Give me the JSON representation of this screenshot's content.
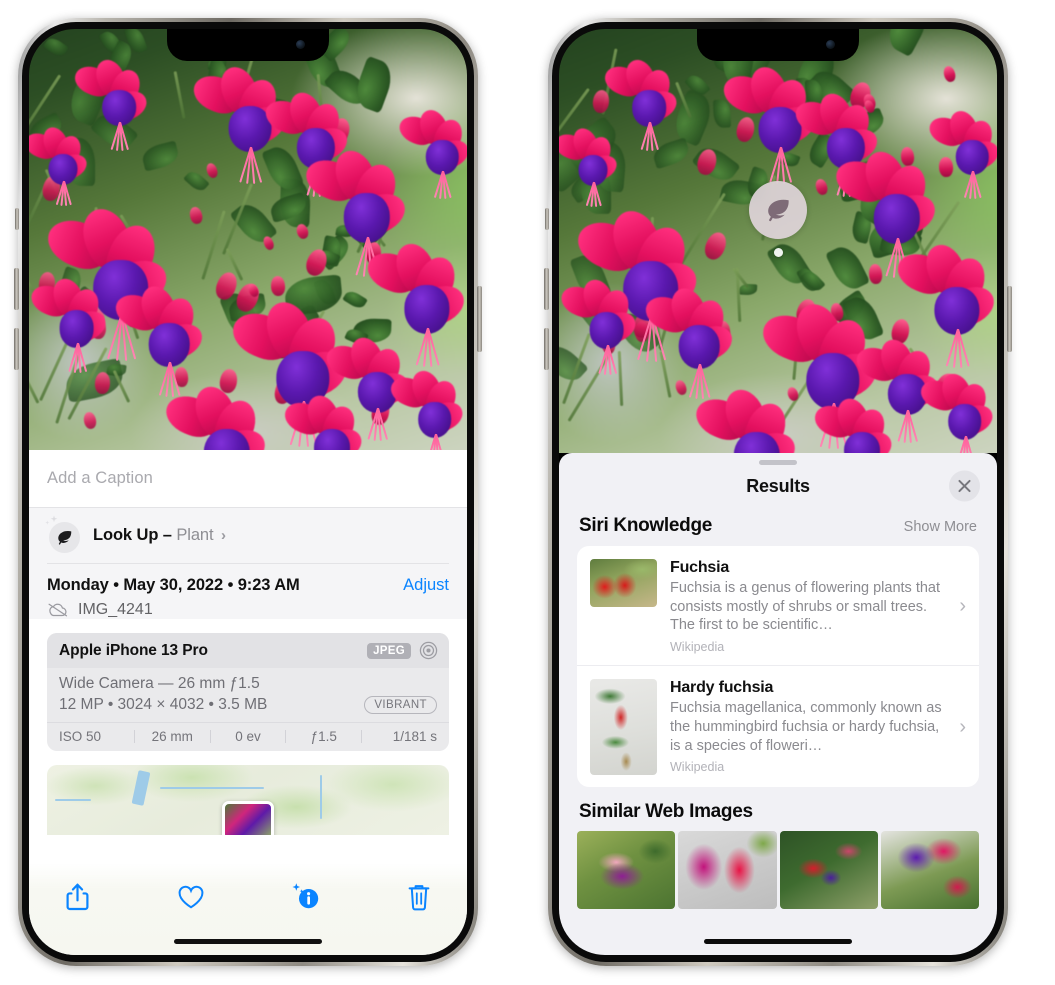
{
  "left_phone": {
    "name": "iPhone showing Photos info panel",
    "caption_placeholder": "Add a Caption",
    "look_up": {
      "label": "Look Up –",
      "subject": "Plant",
      "chevron": "›",
      "icon": "leaf-icon",
      "sparkle_icon": "sparkles-icon"
    },
    "meta": {
      "date": "Monday • May 30, 2022 • 9:23 AM",
      "adjust_label": "Adjust",
      "filename": "IMG_4241",
      "cloud_icon": "cloud-slash-icon"
    },
    "camera_card": {
      "model": "Apple iPhone 13 Pro",
      "format_badge": "JPEG",
      "raw_icon": "aperture-icon",
      "lens_line": "Wide Camera — 26 mm ƒ1.5",
      "spec_line": "12 MP • 3024 × 4032 • 3.5 MB",
      "style_badge": "VIBRANT",
      "exif": [
        "ISO 50",
        "26 mm",
        "0 ev",
        "ƒ1.5",
        "1/181 s"
      ]
    },
    "toolbar": [
      {
        "name": "share-button",
        "icon": "share-icon"
      },
      {
        "name": "favorite-button",
        "icon": "heart-icon"
      },
      {
        "name": "info-button",
        "icon": "info-sparkle-icon"
      },
      {
        "name": "delete-button",
        "icon": "trash-icon"
      }
    ],
    "accent_color": "#0a84ff"
  },
  "right_phone": {
    "name": "iPhone showing Visual Look Up results",
    "badge": {
      "icon": "leaf-icon",
      "label": "visual-look-up-badge"
    },
    "sheet": {
      "title": "Results",
      "close_icon": "close-icon",
      "sections": [
        {
          "title": "Siri Knowledge",
          "action": "Show More",
          "items": [
            {
              "title": "Fuchsia",
              "description": "Fuchsia is a genus of flowering plants that consists mostly of shrubs or small trees. The first to be scientific…",
              "source": "Wikipedia",
              "chevron": "›"
            },
            {
              "title": "Hardy fuchsia",
              "description": "Fuchsia magellanica, commonly known as the hummingbird fuchsia or hardy fuchsia, is a species of floweri…",
              "source": "Wikipedia",
              "chevron": "›"
            }
          ]
        },
        {
          "title": "Similar Web Images",
          "thumbnails": [
            "fuchsia-thumb-1",
            "fuchsia-thumb-2",
            "fuchsia-thumb-3",
            "fuchsia-thumb-4"
          ]
        }
      ]
    }
  },
  "colors": {
    "accent": "#0a84ff",
    "sheet_bg": "#f1f1f5",
    "card_bg": "#ffffff",
    "muted_text": "#8e8e93"
  }
}
